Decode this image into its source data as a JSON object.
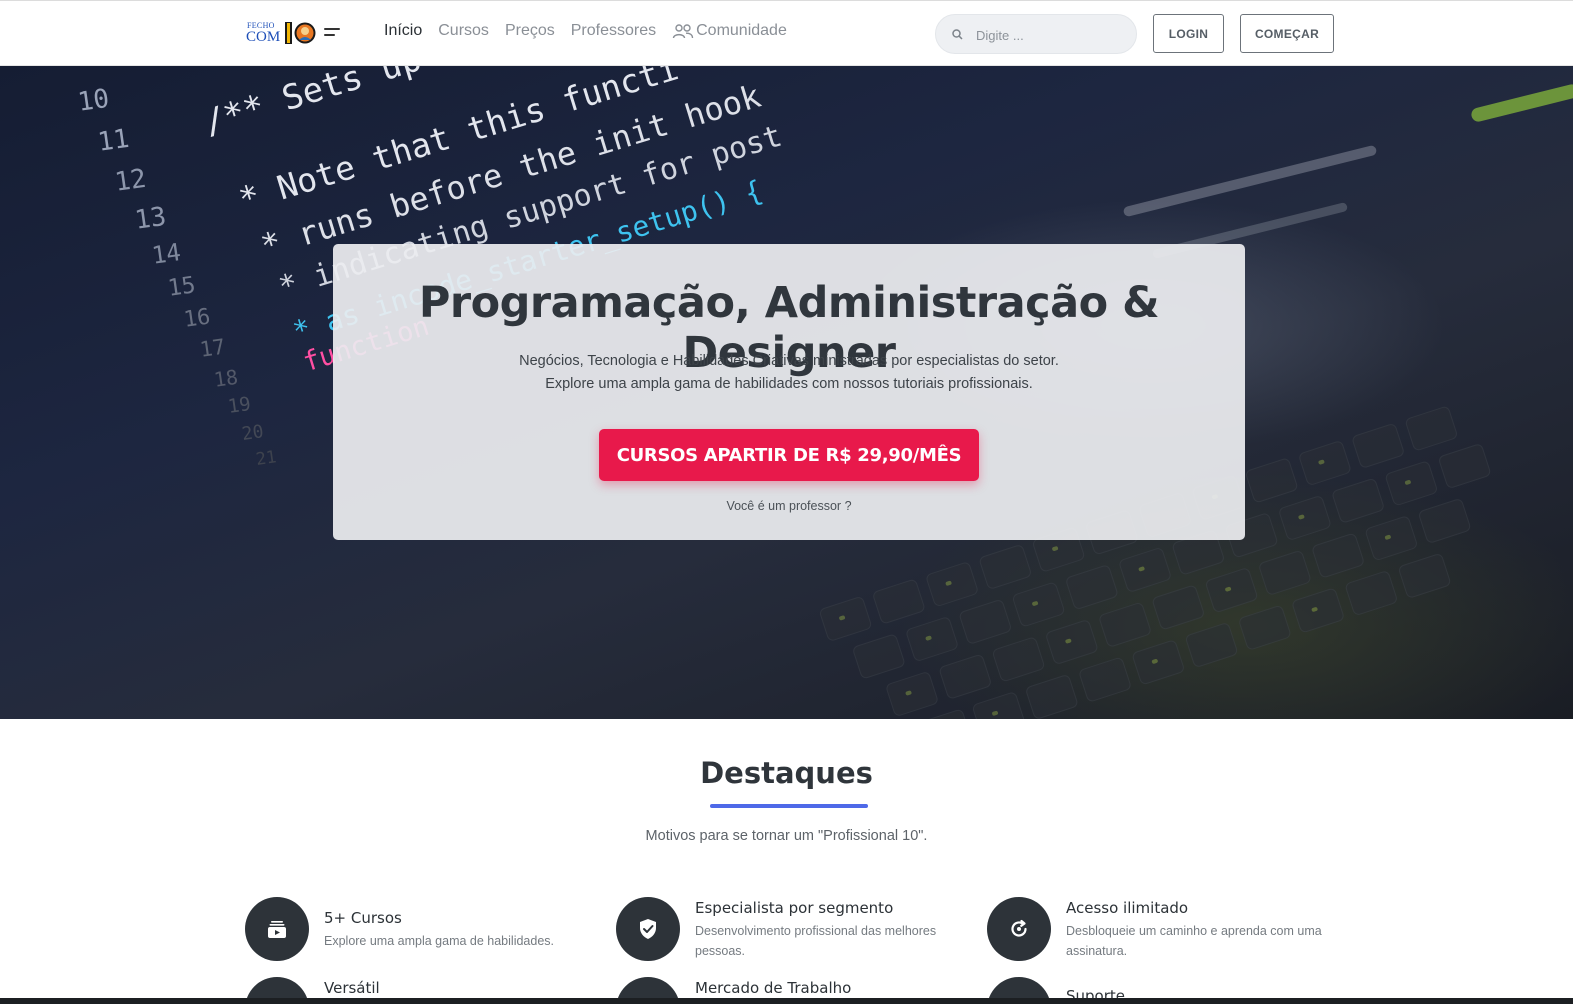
{
  "header": {
    "logo": {
      "line1": "FECHO",
      "line2": "COM",
      "number": "10"
    },
    "nav": [
      {
        "label": "Início",
        "active": true
      },
      {
        "label": "Cursos",
        "active": false
      },
      {
        "label": "Preços",
        "active": false
      },
      {
        "label": "Professores",
        "active": false
      },
      {
        "label": "Comunidade",
        "active": false,
        "icon": "users-icon"
      }
    ],
    "search": {
      "placeholder": "Digite ...",
      "icon": "search-icon"
    },
    "login_label": "LOGIN",
    "start_label": "COMEÇAR"
  },
  "hero": {
    "title": "Programação, Administração & Designer",
    "subtitle": "Negócios, Tecnologia e Habilidades Criativas ministradas por especialistas do setor. Explore uma ampla gama de habilidades com nossos tutoriais profissionais.",
    "cta_label": "CURSOS APARTIR DE R$ 29,90/MÊS",
    "teacher_link": "Você é um professor ?",
    "background_code": {
      "line_numbers": [
        "10",
        "11",
        "12",
        "13",
        "14",
        "15",
        "16",
        "17",
        "18",
        "19",
        "20",
        "21"
      ],
      "lines": [
        "/** Sets up th",
        "* Note that this functi",
        "* runs before the init hook",
        "* indicating support for post",
        "* as incode_starter_setup() {",
        "function"
      ]
    }
  },
  "destaques": {
    "title": "Destaques",
    "subtitle": "Motivos para se tornar um \"Profissional 10\".",
    "features": [
      {
        "title": "5+ Cursos",
        "desc": "Explore uma ampla gama de habilidades.",
        "icon": "video-library-icon"
      },
      {
        "title": "Especialista por segmento",
        "desc": "Desenvolvimento profissional das melhores pessoas.",
        "icon": "shield-check-icon"
      },
      {
        "title": "Acesso ilimitado",
        "desc": "Desbloqueie um caminho e aprenda com uma assinatura.",
        "icon": "refresh-icon"
      },
      {
        "title": "Versátil",
        "desc": "",
        "icon": "versatile-icon"
      },
      {
        "title": "Mercado de Trabalho",
        "desc": "",
        "icon": "briefcase-icon"
      },
      {
        "title": "Suporte",
        "desc": "",
        "icon": "support-icon"
      }
    ]
  },
  "colors": {
    "accent": "#e8194b",
    "underline": "#4e69e8",
    "icon_bg": "#2d3339",
    "logo_blue": "#1e4fb8"
  }
}
